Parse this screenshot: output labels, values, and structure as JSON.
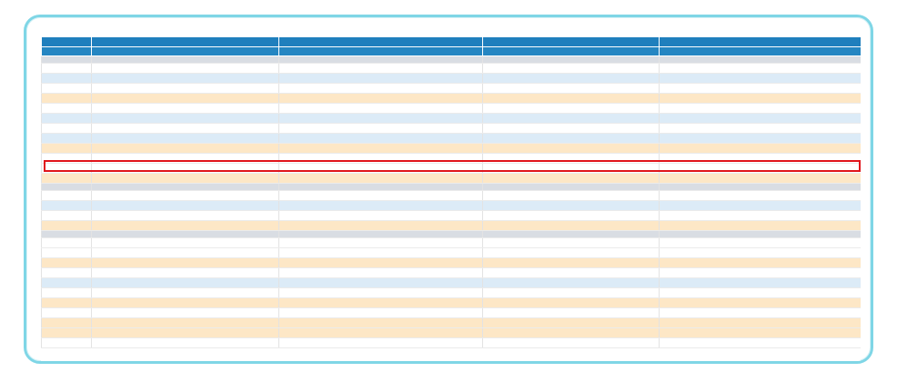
{
  "table": {
    "headers": {
      "description": "",
      "period_end": "",
      "restated_1": "",
      "restated_2": "",
      "change_pct": ""
    },
    "audit_status": {
      "period_end": "",
      "restated_1": "",
      "restated_2": ""
    },
    "rows": [
      {
        "kind": "blank",
        "label": "",
        "v1": "",
        "v2": "",
        "v3": "",
        "pct": ""
      },
      {
        "kind": "section",
        "label": "",
        "v1": "",
        "v2": "",
        "v3": "",
        "pct": ""
      },
      {
        "kind": "blue",
        "label": "",
        "v1": "",
        "v2": "",
        "v3": "",
        "pct": ""
      },
      {
        "kind": "white",
        "label": "",
        "v1": "",
        "v2": "",
        "v3": "",
        "pct": ""
      },
      {
        "kind": "peach",
        "label": "",
        "v1": "",
        "v2": "",
        "v3": "",
        "pct": ""
      },
      {
        "kind": "white",
        "label": "",
        "v1": "",
        "v2": "",
        "v3": "",
        "pct": ""
      },
      {
        "kind": "blue",
        "label": "",
        "v1": "",
        "v2": "",
        "v3": "",
        "pct": ""
      },
      {
        "kind": "white",
        "label": "",
        "v1": "",
        "v2": "",
        "v3": "",
        "pct": ""
      },
      {
        "kind": "blue",
        "label": "",
        "v1": "",
        "v2": "",
        "v3": "",
        "pct": ""
      },
      {
        "kind": "peach",
        "label": "",
        "v1": "",
        "v2": "",
        "v3": "",
        "pct": ""
      },
      {
        "kind": "white",
        "label": "",
        "v1": "",
        "v2": "",
        "v3": "",
        "pct": ""
      },
      {
        "kind": "white",
        "label": "",
        "v1": "",
        "v2": "",
        "v3": "",
        "pct": ""
      },
      {
        "kind": "peach",
        "label": "",
        "v1": "",
        "v2": "",
        "v3": "",
        "pct": ""
      },
      {
        "kind": "blank",
        "label": "",
        "v1": "",
        "v2": "",
        "v3": "",
        "pct": ""
      },
      {
        "kind": "section",
        "label": "",
        "v1": "",
        "v2": "",
        "v3": "",
        "pct": ""
      },
      {
        "kind": "blue",
        "label": "",
        "v1": "",
        "v2": "",
        "v3": "",
        "pct": ""
      },
      {
        "kind": "white",
        "label": "",
        "v1": "",
        "v2": "",
        "v3": "",
        "pct": ""
      },
      {
        "kind": "peach",
        "label": "",
        "v1": "",
        "v2": "",
        "v3": "",
        "pct": ""
      },
      {
        "kind": "blank",
        "label": "",
        "v1": "",
        "v2": "",
        "v3": "",
        "pct": ""
      },
      {
        "kind": "section",
        "label": "",
        "v1": "",
        "v2": "",
        "v3": "",
        "pct": ""
      },
      {
        "kind": "white",
        "label": "",
        "v1": "",
        "v2": "",
        "v3": "",
        "pct": ""
      },
      {
        "kind": "peach",
        "label": "",
        "v1": "",
        "v2": "",
        "v3": "",
        "pct": ""
      },
      {
        "kind": "section",
        "label": "",
        "v1": "",
        "v2": "",
        "v3": "",
        "pct": ""
      },
      {
        "kind": "blue",
        "label": "",
        "v1": "",
        "v2": "",
        "v3": "",
        "pct": ""
      },
      {
        "kind": "white",
        "label": "",
        "v1": "",
        "v2": "",
        "v3": "",
        "pct": ""
      },
      {
        "kind": "peach",
        "label": "",
        "v1": "",
        "v2": "",
        "v3": "",
        "pct": ""
      },
      {
        "kind": "white",
        "label": "",
        "v1": "",
        "v2": "",
        "v3": "",
        "pct": ""
      },
      {
        "kind": "peach",
        "label": "",
        "v1": "",
        "v2": "",
        "v3": "",
        "pct": ""
      },
      {
        "kind": "peach",
        "label": "",
        "v1": "",
        "v2": "",
        "v3": "",
        "pct": ""
      },
      {
        "kind": "white",
        "label": "",
        "v1": "",
        "v2": "",
        "v3": "",
        "pct": ""
      }
    ]
  },
  "colors": {
    "header_blue": "#1f7fbd",
    "negative_red": "#d32b2b",
    "highlight_red": "#e0141b",
    "frame_cyan": "#7fd6e6",
    "row_blue": "#dcebf7",
    "row_peach": "#fde7c6",
    "row_blank": "#d9dde3"
  }
}
